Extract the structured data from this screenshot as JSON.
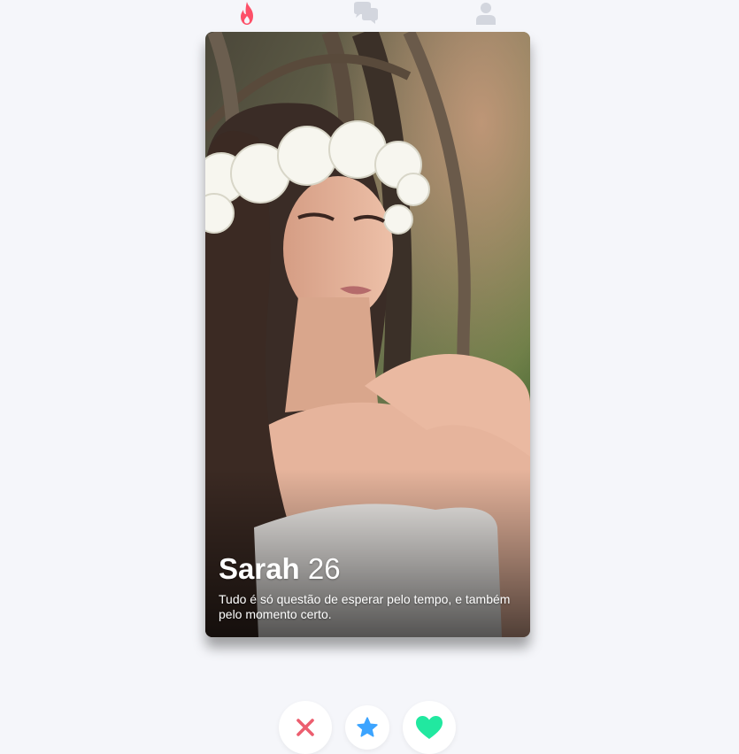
{
  "nav": {
    "items": [
      {
        "icon": "flame-icon",
        "active": true,
        "color": "#fd5068"
      },
      {
        "icon": "chat-icon",
        "active": false,
        "color": "#d3d6de"
      },
      {
        "icon": "user-icon",
        "active": false,
        "color": "#d3d6de"
      }
    ]
  },
  "card": {
    "name": "Sarah",
    "age": "26",
    "bio": "Tudo é só questão de esperar pelo tempo, e também pelo momento certo."
  },
  "actions": {
    "nope": {
      "icon": "close-icon",
      "color": "#ec5e6f"
    },
    "super_like": {
      "icon": "star-icon",
      "color": "#3ca4ff"
    },
    "like": {
      "icon": "heart-icon",
      "color": "#21e8a0"
    }
  }
}
